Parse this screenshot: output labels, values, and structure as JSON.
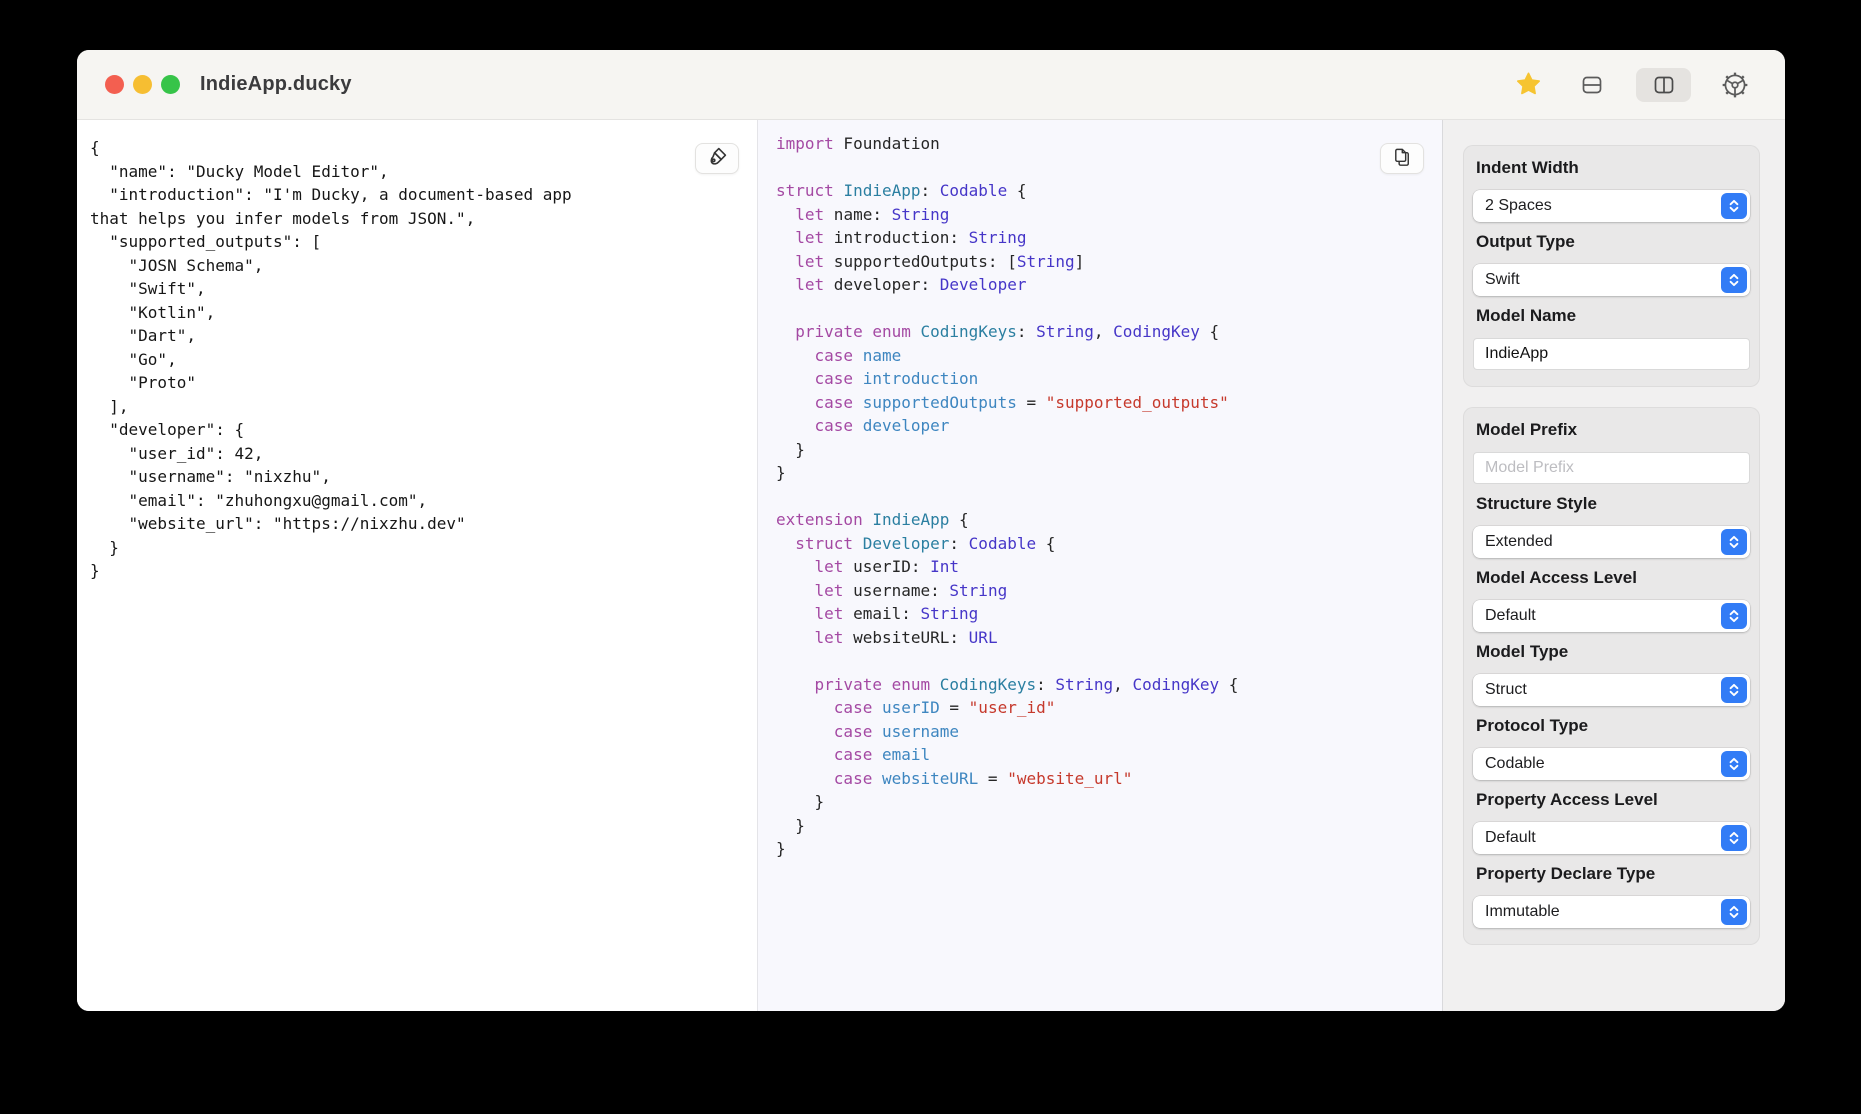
{
  "window": {
    "title": "IndieApp.ducky"
  },
  "toolbar": {
    "icons": [
      "favorite-star",
      "split-horizontal",
      "split-vertical",
      "settings-gear"
    ],
    "active_icon": "split-vertical"
  },
  "json_panel": {
    "content": "{\n  \"name\": \"Ducky Model Editor\",\n  \"introduction\": \"I'm Ducky, a document-based app\nthat helps you infer models from JSON.\",\n  \"supported_outputs\": [\n    \"JOSN Schema\",\n    \"Swift\",\n    \"Kotlin\",\n    \"Dart\",\n    \"Go\",\n    \"Proto\"\n  ],\n  \"developer\": {\n    \"user_id\": 42,\n    \"username\": \"nixzhu\",\n    \"email\": \"zhuhongxu@gmail.com\",\n    \"website_url\": \"https://nixzhu.dev\"\n  }\n}",
    "format_icon": "paintbrush-icon"
  },
  "code_panel": {
    "copy_icon": "copy-doc-icon",
    "lines": [
      [
        {
          "t": "import",
          "c": "kw"
        },
        {
          "t": " Foundation",
          "c": "pl"
        }
      ],
      [],
      [
        {
          "t": "struct",
          "c": "kw"
        },
        {
          "t": " ",
          "c": "pl"
        },
        {
          "t": "IndieApp",
          "c": "decl"
        },
        {
          "t": ": ",
          "c": "pl"
        },
        {
          "t": "Codable",
          "c": "ty"
        },
        {
          "t": " {",
          "c": "pl"
        }
      ],
      [
        {
          "t": "  ",
          "c": "pl"
        },
        {
          "t": "let",
          "c": "kw"
        },
        {
          "t": " name: ",
          "c": "pl"
        },
        {
          "t": "String",
          "c": "ty"
        }
      ],
      [
        {
          "t": "  ",
          "c": "pl"
        },
        {
          "t": "let",
          "c": "kw"
        },
        {
          "t": " introduction: ",
          "c": "pl"
        },
        {
          "t": "String",
          "c": "ty"
        }
      ],
      [
        {
          "t": "  ",
          "c": "pl"
        },
        {
          "t": "let",
          "c": "kw"
        },
        {
          "t": " supportedOutputs: [",
          "c": "pl"
        },
        {
          "t": "String",
          "c": "ty"
        },
        {
          "t": "]",
          "c": "pl"
        }
      ],
      [
        {
          "t": "  ",
          "c": "pl"
        },
        {
          "t": "let",
          "c": "kw"
        },
        {
          "t": " developer: ",
          "c": "pl"
        },
        {
          "t": "Developer",
          "c": "ty"
        }
      ],
      [],
      [
        {
          "t": "  ",
          "c": "pl"
        },
        {
          "t": "private",
          "c": "kw"
        },
        {
          "t": " ",
          "c": "pl"
        },
        {
          "t": "enum",
          "c": "kw"
        },
        {
          "t": " ",
          "c": "pl"
        },
        {
          "t": "CodingKeys",
          "c": "decl"
        },
        {
          "t": ": ",
          "c": "pl"
        },
        {
          "t": "String",
          "c": "ty"
        },
        {
          "t": ", ",
          "c": "pl"
        },
        {
          "t": "CodingKey",
          "c": "ty"
        },
        {
          "t": " {",
          "c": "pl"
        }
      ],
      [
        {
          "t": "    ",
          "c": "pl"
        },
        {
          "t": "case",
          "c": "kw"
        },
        {
          "t": " ",
          "c": "pl"
        },
        {
          "t": "name",
          "c": "mem"
        }
      ],
      [
        {
          "t": "    ",
          "c": "pl"
        },
        {
          "t": "case",
          "c": "kw"
        },
        {
          "t": " ",
          "c": "pl"
        },
        {
          "t": "introduction",
          "c": "mem"
        }
      ],
      [
        {
          "t": "    ",
          "c": "pl"
        },
        {
          "t": "case",
          "c": "kw"
        },
        {
          "t": " ",
          "c": "pl"
        },
        {
          "t": "supportedOutputs",
          "c": "mem"
        },
        {
          "t": " = ",
          "c": "pl"
        },
        {
          "t": "\"supported_outputs\"",
          "c": "str"
        }
      ],
      [
        {
          "t": "    ",
          "c": "pl"
        },
        {
          "t": "case",
          "c": "kw"
        },
        {
          "t": " ",
          "c": "pl"
        },
        {
          "t": "developer",
          "c": "mem"
        }
      ],
      [
        {
          "t": "  }",
          "c": "pl"
        }
      ],
      [
        {
          "t": "}",
          "c": "pl"
        }
      ],
      [],
      [
        {
          "t": "extension",
          "c": "kw"
        },
        {
          "t": " ",
          "c": "pl"
        },
        {
          "t": "IndieApp",
          "c": "decl"
        },
        {
          "t": " {",
          "c": "pl"
        }
      ],
      [
        {
          "t": "  ",
          "c": "pl"
        },
        {
          "t": "struct",
          "c": "kw"
        },
        {
          "t": " ",
          "c": "pl"
        },
        {
          "t": "Developer",
          "c": "decl"
        },
        {
          "t": ": ",
          "c": "pl"
        },
        {
          "t": "Codable",
          "c": "ty"
        },
        {
          "t": " {",
          "c": "pl"
        }
      ],
      [
        {
          "t": "    ",
          "c": "pl"
        },
        {
          "t": "let",
          "c": "kw"
        },
        {
          "t": " userID: ",
          "c": "pl"
        },
        {
          "t": "Int",
          "c": "ty"
        }
      ],
      [
        {
          "t": "    ",
          "c": "pl"
        },
        {
          "t": "let",
          "c": "kw"
        },
        {
          "t": " username: ",
          "c": "pl"
        },
        {
          "t": "String",
          "c": "ty"
        }
      ],
      [
        {
          "t": "    ",
          "c": "pl"
        },
        {
          "t": "let",
          "c": "kw"
        },
        {
          "t": " email: ",
          "c": "pl"
        },
        {
          "t": "String",
          "c": "ty"
        }
      ],
      [
        {
          "t": "    ",
          "c": "pl"
        },
        {
          "t": "let",
          "c": "kw"
        },
        {
          "t": " websiteURL: ",
          "c": "pl"
        },
        {
          "t": "URL",
          "c": "ty"
        }
      ],
      [],
      [
        {
          "t": "    ",
          "c": "pl"
        },
        {
          "t": "private",
          "c": "kw"
        },
        {
          "t": " ",
          "c": "pl"
        },
        {
          "t": "enum",
          "c": "kw"
        },
        {
          "t": " ",
          "c": "pl"
        },
        {
          "t": "CodingKeys",
          "c": "decl"
        },
        {
          "t": ": ",
          "c": "pl"
        },
        {
          "t": "String",
          "c": "ty"
        },
        {
          "t": ", ",
          "c": "pl"
        },
        {
          "t": "CodingKey",
          "c": "ty"
        },
        {
          "t": " {",
          "c": "pl"
        }
      ],
      [
        {
          "t": "      ",
          "c": "pl"
        },
        {
          "t": "case",
          "c": "kw"
        },
        {
          "t": " ",
          "c": "pl"
        },
        {
          "t": "userID",
          "c": "mem"
        },
        {
          "t": " = ",
          "c": "pl"
        },
        {
          "t": "\"user_id\"",
          "c": "str"
        }
      ],
      [
        {
          "t": "      ",
          "c": "pl"
        },
        {
          "t": "case",
          "c": "kw"
        },
        {
          "t": " ",
          "c": "pl"
        },
        {
          "t": "username",
          "c": "mem"
        }
      ],
      [
        {
          "t": "      ",
          "c": "pl"
        },
        {
          "t": "case",
          "c": "kw"
        },
        {
          "t": " ",
          "c": "pl"
        },
        {
          "t": "email",
          "c": "mem"
        }
      ],
      [
        {
          "t": "      ",
          "c": "pl"
        },
        {
          "t": "case",
          "c": "kw"
        },
        {
          "t": " ",
          "c": "pl"
        },
        {
          "t": "websiteURL",
          "c": "mem"
        },
        {
          "t": " = ",
          "c": "pl"
        },
        {
          "t": "\"website_url\"",
          "c": "str"
        }
      ],
      [
        {
          "t": "    }",
          "c": "pl"
        }
      ],
      [
        {
          "t": "  }",
          "c": "pl"
        }
      ],
      [
        {
          "t": "}",
          "c": "pl"
        }
      ]
    ]
  },
  "sidebar": {
    "groups": [
      {
        "fields": [
          {
            "label": "Indent Width",
            "type": "select",
            "value": "2 Spaces"
          },
          {
            "label": "Output Type",
            "type": "select",
            "value": "Swift"
          },
          {
            "label": "Model Name",
            "type": "text",
            "value": "IndieApp",
            "placeholder": ""
          }
        ]
      },
      {
        "fields": [
          {
            "label": "Model Prefix",
            "type": "text",
            "value": "",
            "placeholder": "Model Prefix"
          },
          {
            "label": "Structure Style",
            "type": "select",
            "value": "Extended"
          },
          {
            "label": "Model Access Level",
            "type": "select",
            "value": "Default"
          },
          {
            "label": "Model Type",
            "type": "select",
            "value": "Struct"
          },
          {
            "label": "Protocol Type",
            "type": "select",
            "value": "Codable"
          },
          {
            "label": "Property Access Level",
            "type": "select",
            "value": "Default"
          },
          {
            "label": "Property Declare Type",
            "type": "select",
            "value": "Immutable"
          }
        ]
      }
    ]
  },
  "colors": {
    "accent": "#327CF6",
    "star": "#F6C431",
    "keyword": "#A449A3",
    "type_decl": "#2B7FA1",
    "type_ref": "#4636C8",
    "member": "#3E86C0",
    "string": "#C6392C",
    "traffic_red": "#F35F50",
    "traffic_yellow": "#F6BE32",
    "traffic_green": "#37C449"
  }
}
